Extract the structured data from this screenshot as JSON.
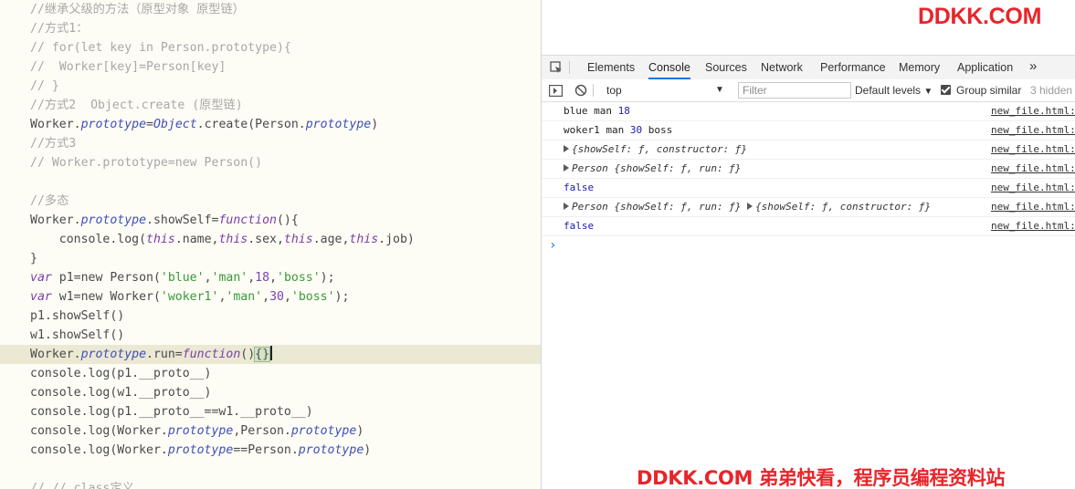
{
  "editor": {
    "lines": [
      [
        {
          "cls": "c",
          "text": "//继承父级的方法（原型对象 原型链）"
        }
      ],
      [
        {
          "cls": "c",
          "text": "//方式1："
        }
      ],
      [
        {
          "cls": "c",
          "text": "// for(let key in Person.prototype){"
        }
      ],
      [
        {
          "cls": "c",
          "text": "//  Worker[key]=Person[key]"
        }
      ],
      [
        {
          "cls": "c",
          "text": "// }"
        }
      ],
      [
        {
          "cls": "c",
          "text": "//方式2  Object.create (原型链)"
        }
      ],
      [
        {
          "cls": "",
          "text": "Worker."
        },
        {
          "cls": "pr",
          "text": "prototype"
        },
        {
          "cls": "",
          "text": "="
        },
        {
          "cls": "pr",
          "text": "Object"
        },
        {
          "cls": "",
          "text": ".create(Person."
        },
        {
          "cls": "pr",
          "text": "prototype"
        },
        {
          "cls": "",
          "text": ")"
        }
      ],
      [
        {
          "cls": "c",
          "text": "//方式3"
        }
      ],
      [
        {
          "cls": "c",
          "text": "// Worker.prototype=new Person()"
        }
      ],
      [
        {
          "cls": "",
          "text": ""
        }
      ],
      [
        {
          "cls": "c",
          "text": "//多态"
        }
      ],
      [
        {
          "cls": "",
          "text": "Worker."
        },
        {
          "cls": "pr",
          "text": "prototype"
        },
        {
          "cls": "",
          "text": ".showSelf="
        },
        {
          "cls": "kw",
          "text": "function"
        },
        {
          "cls": "",
          "text": "(){"
        }
      ],
      [
        {
          "cls": "",
          "text": "    console.log("
        },
        {
          "cls": "kw",
          "text": "this"
        },
        {
          "cls": "",
          "text": ".name,"
        },
        {
          "cls": "kw",
          "text": "this"
        },
        {
          "cls": "",
          "text": ".sex,"
        },
        {
          "cls": "kw",
          "text": "this"
        },
        {
          "cls": "",
          "text": ".age,"
        },
        {
          "cls": "kw",
          "text": "this"
        },
        {
          "cls": "",
          "text": ".job)"
        }
      ],
      [
        {
          "cls": "",
          "text": "}"
        }
      ],
      [
        {
          "cls": "kw",
          "text": "var"
        },
        {
          "cls": "",
          "text": " p1=new Person("
        },
        {
          "cls": "st",
          "text": "'blue'"
        },
        {
          "cls": "",
          "text": ","
        },
        {
          "cls": "st",
          "text": "'man'"
        },
        {
          "cls": "",
          "text": ","
        },
        {
          "cls": "nm",
          "text": "18"
        },
        {
          "cls": "",
          "text": ","
        },
        {
          "cls": "st",
          "text": "'boss'"
        },
        {
          "cls": "",
          "text": ");"
        }
      ],
      [
        {
          "cls": "kw",
          "text": "var"
        },
        {
          "cls": "",
          "text": " w1=new Worker("
        },
        {
          "cls": "st",
          "text": "'woker1'"
        },
        {
          "cls": "",
          "text": ","
        },
        {
          "cls": "st",
          "text": "'man'"
        },
        {
          "cls": "",
          "text": ","
        },
        {
          "cls": "nm",
          "text": "30"
        },
        {
          "cls": "",
          "text": ","
        },
        {
          "cls": "st",
          "text": "'boss'"
        },
        {
          "cls": "",
          "text": ");"
        }
      ],
      [
        {
          "cls": "",
          "text": "p1.showSelf()"
        }
      ],
      [
        {
          "cls": "",
          "text": "w1.showSelf()"
        }
      ],
      [
        {
          "cls": "",
          "text": "Worker."
        },
        {
          "cls": "pr",
          "text": "prototype"
        },
        {
          "cls": "",
          "text": ".run="
        },
        {
          "cls": "kw",
          "text": "function"
        },
        {
          "cls": "",
          "text": "()"
        },
        {
          "cls": "br",
          "text": "{}"
        }
      ],
      [
        {
          "cls": "",
          "text": "console.log(p1.__proto__)"
        }
      ],
      [
        {
          "cls": "",
          "text": "console.log(w1.__proto__)"
        }
      ],
      [
        {
          "cls": "",
          "text": "console.log(p1.__proto__==w1.__proto__)"
        }
      ],
      [
        {
          "cls": "",
          "text": "console.log(Worker."
        },
        {
          "cls": "pr",
          "text": "prototype"
        },
        {
          "cls": "",
          "text": ",Person."
        },
        {
          "cls": "pr",
          "text": "prototype"
        },
        {
          "cls": "",
          "text": ")"
        }
      ],
      [
        {
          "cls": "",
          "text": "console.log(Worker."
        },
        {
          "cls": "pr",
          "text": "prototype"
        },
        {
          "cls": "",
          "text": "==Person."
        },
        {
          "cls": "pr",
          "text": "prototype"
        },
        {
          "cls": "",
          "text": ")"
        }
      ],
      [
        {
          "cls": "",
          "text": ""
        }
      ],
      [
        {
          "cls": "c",
          "text": "// // class定义"
        }
      ]
    ],
    "current_line": 18
  },
  "devtools": {
    "watermark_top": "DDKK.COM",
    "tabs": [
      "Elements",
      "Console",
      "Sources",
      "Network",
      "Performance",
      "Memory",
      "Application"
    ],
    "active_tab": "Console",
    "more_tabs": "»",
    "context": "top",
    "filter_placeholder": "Filter",
    "levels": "Default levels",
    "group_similar": "Group similar",
    "hidden_count": "3 hidden",
    "messages": [
      {
        "parts": [
          {
            "cls": "",
            "text": "blue man "
          },
          {
            "cls": "num",
            "text": "18"
          }
        ],
        "src": "new_file.html:"
      },
      {
        "parts": [
          {
            "cls": "",
            "text": "woker1 man "
          },
          {
            "cls": "num",
            "text": "30"
          },
          {
            "cls": "",
            "text": " boss"
          }
        ],
        "src": "new_file.html:"
      },
      {
        "parts": [
          {
            "cls": "tri",
            "text": ""
          },
          {
            "cls": "obj",
            "text": "{showSelf: ƒ, constructor: ƒ}"
          }
        ],
        "src": "new_file.html:"
      },
      {
        "parts": [
          {
            "cls": "tri",
            "text": ""
          },
          {
            "cls": "obj",
            "text": "Person {showSelf: ƒ, run: ƒ}"
          }
        ],
        "src": "new_file.html:"
      },
      {
        "parts": [
          {
            "cls": "bool",
            "text": "false"
          }
        ],
        "src": "new_file.html:"
      },
      {
        "parts": [
          {
            "cls": "tri",
            "text": ""
          },
          {
            "cls": "obj",
            "text": "Person {showSelf: ƒ, run: ƒ} "
          },
          {
            "cls": "tri",
            "text": ""
          },
          {
            "cls": "obj",
            "text": "{showSelf: ƒ, constructor: ƒ}"
          }
        ],
        "src": "new_file.html:"
      },
      {
        "parts": [
          {
            "cls": "bool",
            "text": "false"
          }
        ],
        "src": "new_file.html:"
      }
    ],
    "prompt": "›",
    "watermark_bottom": "DDKK.COM 弟弟快看，程序员编程资料站"
  },
  "colors": {
    "accent": "#1a73e8",
    "watermark": "#e8252a",
    "editor_bg": "#fdfcf5",
    "current_line": "#ebe8d4"
  }
}
